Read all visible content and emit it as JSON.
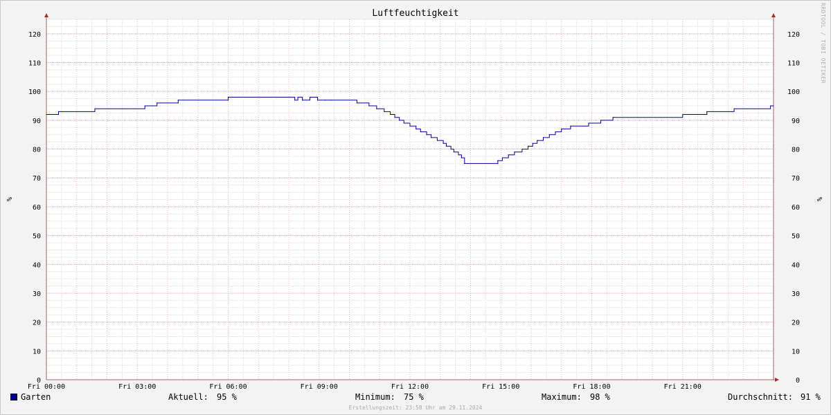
{
  "watermark": "RRDTOOL / TOBI OETIKER",
  "footer": "Erstellungszeit: 23:58 Uhr am 29.11.2024",
  "legend": {
    "series_name": "Garten",
    "current_label": "Aktuell:",
    "current_value": "95 %",
    "min_label": "Minimum:",
    "min_value": "75 %",
    "max_label": "Maximum:",
    "max_value": "98 %",
    "avg_label": "Durchschnitt:",
    "avg_value": "91 %",
    "color": "#000099"
  },
  "chart_data": {
    "type": "line",
    "title": "Luftfeuchtigkeit",
    "ylabel": "%",
    "y2label": "%",
    "ylim": [
      0,
      125
    ],
    "yticks": [
      0,
      10,
      20,
      30,
      40,
      50,
      60,
      70,
      80,
      90,
      100,
      110,
      120
    ],
    "xlim": [
      0,
      24
    ],
    "xticks": [
      {
        "value": 0,
        "label": "Fri 00:00"
      },
      {
        "value": 3,
        "label": "Fri 03:00"
      },
      {
        "value": 6,
        "label": "Fri 06:00"
      },
      {
        "value": 9,
        "label": "Fri 09:00"
      },
      {
        "value": 12,
        "label": "Fri 12:00"
      },
      {
        "value": 15,
        "label": "Fri 15:00"
      },
      {
        "value": 18,
        "label": "Fri 18:00"
      },
      {
        "value": 21,
        "label": "Fri 21:00"
      }
    ],
    "grid": true,
    "series": [
      {
        "name": "Garten",
        "color": "#000099",
        "x": [
          0,
          0.4,
          1.6,
          3.25,
          3.65,
          4.35,
          6.0,
          8.2,
          8.3,
          8.45,
          8.7,
          8.95,
          9.2,
          9.4,
          10.25,
          10.65,
          10.9,
          11.15,
          11.35,
          11.5,
          11.65,
          11.8,
          12.0,
          12.2,
          12.35,
          12.55,
          12.7,
          12.9,
          13.1,
          13.2,
          13.35,
          13.45,
          13.6,
          13.7,
          13.8,
          14.9,
          15.05,
          15.25,
          15.45,
          15.7,
          15.9,
          16.05,
          16.2,
          16.4,
          16.6,
          16.8,
          17.0,
          17.3,
          17.9,
          18.3,
          18.7,
          21.0,
          21.8,
          22.7,
          23.9,
          24.0
        ],
        "y": [
          92,
          93,
          94,
          95,
          96,
          97,
          98,
          97,
          98,
          97,
          98,
          97,
          97,
          97,
          96,
          95,
          94,
          93,
          92,
          91,
          90,
          89,
          88,
          87,
          86,
          85,
          84,
          83,
          82,
          81,
          80,
          79,
          78,
          77,
          75,
          76,
          77,
          78,
          79,
          80,
          81,
          82,
          83,
          84,
          85,
          86,
          87,
          88,
          89,
          90,
          91,
          92,
          93,
          94,
          95,
          95
        ]
      }
    ]
  }
}
